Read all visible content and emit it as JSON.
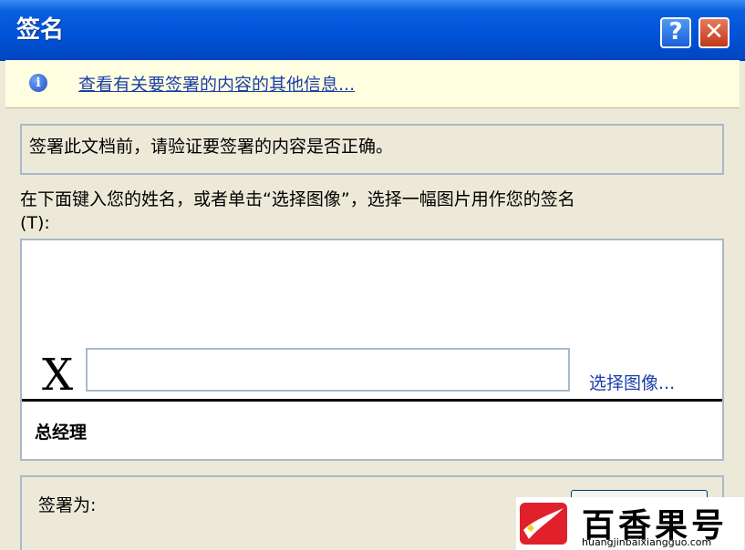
{
  "window": {
    "title": "签名"
  },
  "titlebar_buttons": {
    "help": "?",
    "close": "✕"
  },
  "infobar": {
    "icon": "info-icon",
    "link": "查看有关要签署的内容的其他信息..."
  },
  "instruction": "签署此文档前，请验证要签署的内容是否正确。",
  "prompt": {
    "line1": "在下面键入您的姓名，或者单击“选择图像”，选择一幅图片用作您的签名",
    "line2": "(T):"
  },
  "signature": {
    "x_mark": "X",
    "input_value": "",
    "select_image_link": "选择图像...",
    "signer_title": "总经理"
  },
  "sign_as": {
    "label": "签署为:",
    "button_label": ""
  },
  "watermark": {
    "brand": "百香果号",
    "url": "huangjinbaixiangguo.com"
  }
}
